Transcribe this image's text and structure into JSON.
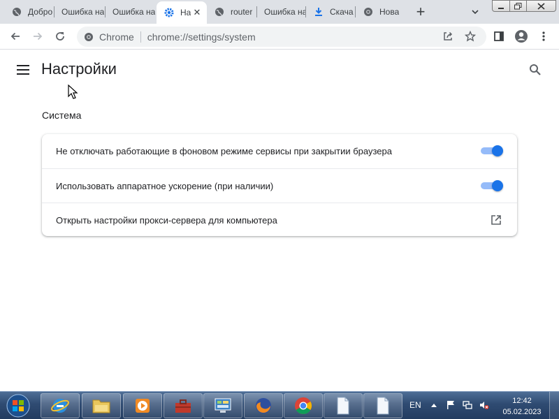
{
  "tabs": [
    {
      "label": "Добро",
      "icon": "globe-icon",
      "active": false
    },
    {
      "label": "Ошибка на",
      "icon": "none",
      "active": false
    },
    {
      "label": "Ошибка на",
      "icon": "none",
      "active": false
    },
    {
      "label": "На",
      "icon": "gear-icon",
      "active": true
    },
    {
      "label": "router",
      "icon": "globe-icon",
      "active": false
    },
    {
      "label": "Ошибка на",
      "icon": "none",
      "active": false
    },
    {
      "label": "Скача",
      "icon": "download-icon",
      "active": false
    },
    {
      "label": "Нова",
      "icon": "chrome-icon",
      "active": false
    }
  ],
  "omnibox": {
    "chip": "Chrome",
    "url": "chrome://settings/system"
  },
  "page": {
    "title": "Настройки",
    "section_title": "Система"
  },
  "settings": [
    {
      "label": "Не отключать работающие в фоновом режиме сервисы при закрытии браузера",
      "control": "toggle",
      "enabled": true
    },
    {
      "label": "Использовать аппаратное ускорение (при наличии)",
      "control": "toggle",
      "enabled": true
    },
    {
      "label": "Открыть настройки прокси-сервера для компьютера",
      "control": "external-link"
    }
  ],
  "taskbar": {
    "language": "EN",
    "time": "12:42",
    "date": "05.02.2023",
    "items": [
      "internet-explorer-icon",
      "file-explorer-icon",
      "media-player-icon",
      "toolbox-icon",
      "control-panel-icon",
      "firefox-icon",
      "chrome-icon",
      "document-icon",
      "document-icon"
    ]
  },
  "colors": {
    "accent": "#1a73e8",
    "toggle_track": "#8ab4f8",
    "tabstrip": "#dee1e6",
    "omnibox": "#f1f3f4"
  }
}
